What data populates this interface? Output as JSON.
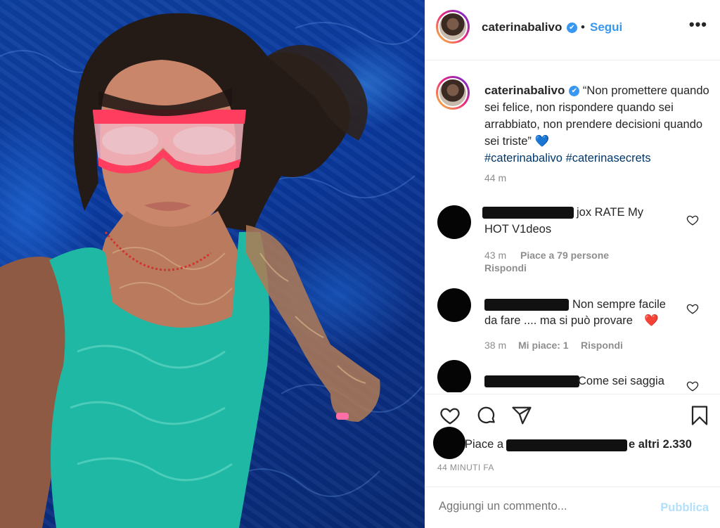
{
  "post": {
    "username": "caterinabalivo",
    "verified_mark": "✔",
    "follow_separator": "•",
    "follow_label": "Segui",
    "more_label": "•••",
    "caption_text": "“Non promettere quando sei felice, non rispondere quando sei arrabbiato, non prendere decisioni quando sei triste”",
    "caption_emoji": "💙",
    "hashtags": "#caterinabalivo #caterinasecrets",
    "caption_time": "44 m"
  },
  "comments": [
    {
      "text_line1": "jox RATE My",
      "text_line2": "HOT V1deos",
      "time": "43 m",
      "likes": "Piace a 79 persone",
      "reply": "Rispondi",
      "like_icon": "heart-outline-icon"
    },
    {
      "text_line1": "Non sempre facile",
      "text_line2": "da fare .... ma si può provare",
      "emoji": "❤️",
      "time": "38 m",
      "likes": "Mi piace: 1",
      "reply": "Rispondi",
      "like_icon": "heart-outline-icon"
    },
    {
      "text_line1": "Come sei saggia",
      "like_icon": "heart-outline-icon"
    }
  ],
  "actions": {
    "icons": [
      "heart-icon",
      "comment-icon",
      "share-icon",
      "bookmark-icon"
    ]
  },
  "likes": {
    "prefix": "Piace a",
    "others": "e altri 2.330"
  },
  "timestamp": "44 MINUTI FA",
  "add_comment": {
    "placeholder": "Aggiungi un commento...",
    "post_label": "Pubblica"
  },
  "colors": {
    "accent": "#3897f0",
    "hashtag": "#00376b",
    "muted": "#8e8e8e",
    "post_disabled": "#b2dffc",
    "pool": "#0b3a9e"
  }
}
